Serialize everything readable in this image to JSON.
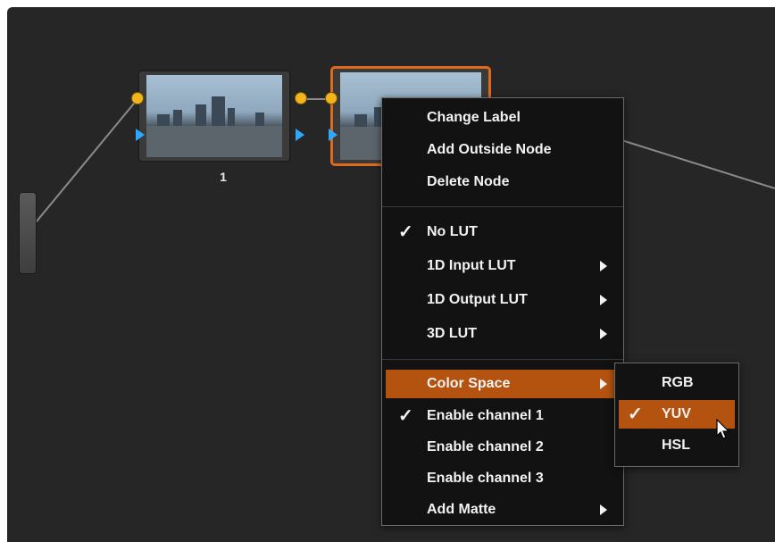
{
  "nodes": [
    {
      "label": "1"
    }
  ],
  "context_menu": {
    "items_group1": [
      {
        "label": "Change Label"
      },
      {
        "label": "Add Outside Node"
      },
      {
        "label": "Delete Node"
      }
    ],
    "items_group2": [
      {
        "label": "No LUT",
        "checked": true,
        "submenu": false
      },
      {
        "label": "1D Input LUT",
        "checked": false,
        "submenu": true
      },
      {
        "label": "1D Output LUT",
        "checked": false,
        "submenu": true
      },
      {
        "label": "3D LUT",
        "checked": false,
        "submenu": true
      }
    ],
    "items_group3": [
      {
        "label": "Color Space",
        "checked": false,
        "submenu": true,
        "highlighted": true
      },
      {
        "label": "Enable channel 1",
        "checked": true,
        "submenu": false
      },
      {
        "label": "Enable channel 2",
        "checked": false,
        "submenu": false
      },
      {
        "label": "Enable channel 3",
        "checked": false,
        "submenu": false
      },
      {
        "label": "Add Matte",
        "checked": false,
        "submenu": true
      }
    ]
  },
  "color_space_submenu": [
    {
      "label": "RGB",
      "checked": false
    },
    {
      "label": "YUV",
      "checked": true,
      "highlighted": true
    },
    {
      "label": "HSL",
      "checked": false
    }
  ],
  "colors": {
    "background": "#262626",
    "highlight": "#b3530f",
    "selected_node_border": "#e06a1c",
    "port_output": "#f3b51d",
    "port_input": "#2ba8ff"
  },
  "check_glyph": "✓"
}
